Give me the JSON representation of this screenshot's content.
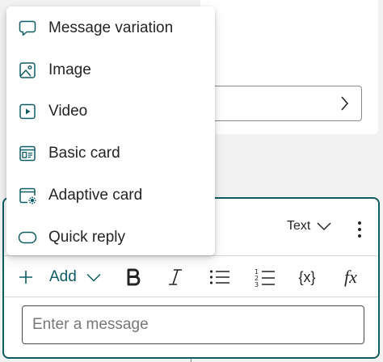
{
  "menu": {
    "items": [
      {
        "label": "Message variation",
        "icon": "message-variation-icon"
      },
      {
        "label": "Image",
        "icon": "image-icon"
      },
      {
        "label": "Video",
        "icon": "video-icon"
      },
      {
        "label": "Basic card",
        "icon": "basic-card-icon"
      },
      {
        "label": "Adaptive card",
        "icon": "adaptive-card-icon"
      },
      {
        "label": "Quick reply",
        "icon": "quick-reply-icon"
      }
    ]
  },
  "message_node": {
    "type_select": {
      "value": "Text"
    },
    "toolbar": {
      "add_label": "Add",
      "variable_label": "{x}",
      "formula_label": "fx"
    },
    "input": {
      "placeholder": "Enter a message",
      "value": ""
    }
  },
  "colors": {
    "accent": "#0e5c63",
    "text": "#242424",
    "placeholder": "#777777",
    "canvas": "#f2f2f2"
  }
}
